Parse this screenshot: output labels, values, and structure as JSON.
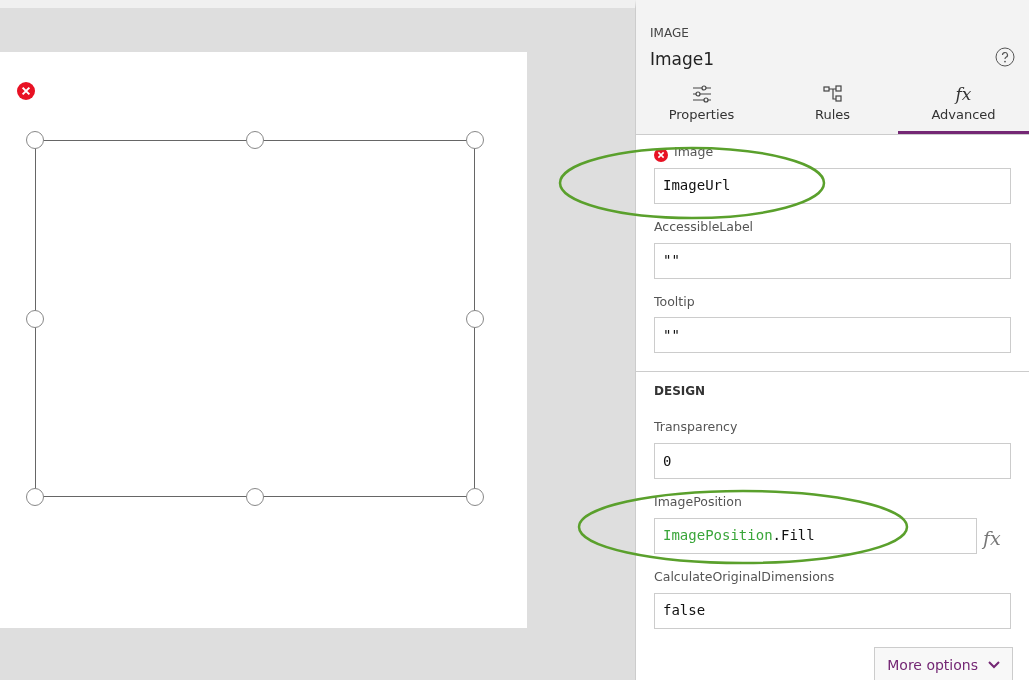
{
  "canvas": {
    "selection_error": true
  },
  "panel": {
    "type_label": "IMAGE",
    "name": "Image1",
    "tabs": [
      {
        "label": "Properties",
        "kind": "sliders",
        "selected": false
      },
      {
        "label": "Rules",
        "kind": "tree",
        "selected": false
      },
      {
        "label": "Advanced",
        "kind": "glyph",
        "glyph": "fx",
        "selected": true
      }
    ],
    "sections": [
      {
        "properties": [
          {
            "label": "Image",
            "error": true,
            "value": [
              {
                "text": "ImageUrl",
                "kind": "plain"
              }
            ]
          },
          {
            "label": "AccessibleLabel",
            "error": false,
            "value": [
              {
                "text": "\"\"",
                "kind": "plain"
              }
            ]
          },
          {
            "label": "Tooltip",
            "error": false,
            "value": [
              {
                "text": "\"\"",
                "kind": "plain"
              }
            ]
          }
        ]
      },
      {
        "title": "DESIGN",
        "properties": [
          {
            "label": "Transparency",
            "error": false,
            "value": [
              {
                "text": "0",
                "kind": "plain"
              }
            ]
          },
          {
            "label": "ImagePosition",
            "error": false,
            "value": [
              {
                "text": "ImagePosition",
                "kind": "enum"
              },
              {
                "text": ".Fill",
                "kind": "plain"
              }
            ],
            "formula_button": "fx"
          },
          {
            "label": "CalculateOriginalDimensions",
            "error": false,
            "value": [
              {
                "text": "false",
                "kind": "plain"
              }
            ]
          }
        ]
      }
    ],
    "more_button": "More options"
  }
}
